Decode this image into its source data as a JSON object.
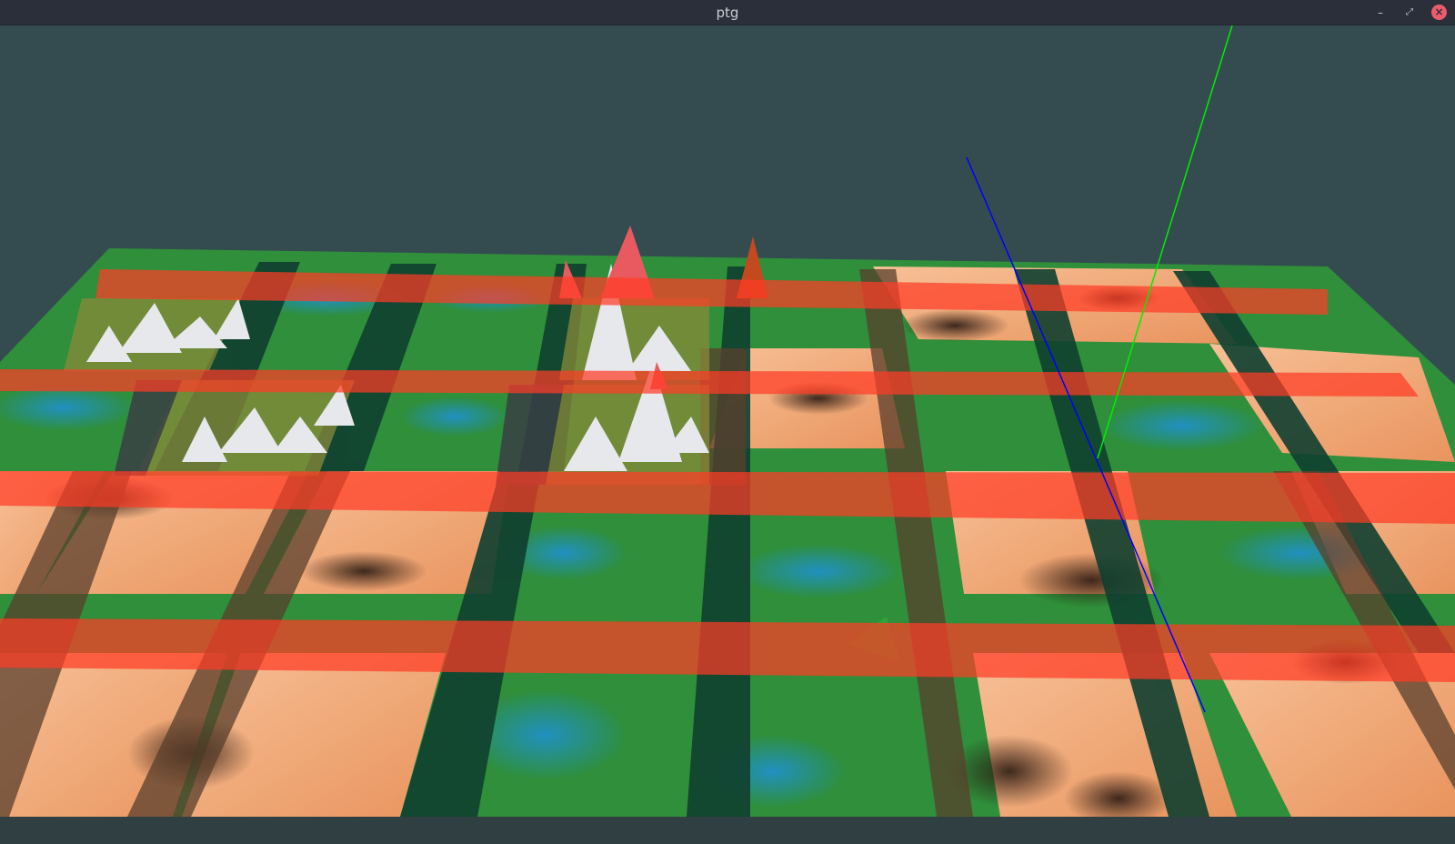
{
  "window": {
    "title": "ptg",
    "controls": {
      "minimize_glyph": "–",
      "maximize_glyph": "⤢",
      "close_glyph": "×"
    }
  },
  "viewport": {
    "content": "3d-terrain-render",
    "colors": {
      "background": "#344c50",
      "terrain_green": "#2f8f3a",
      "terrain_water": "#1e8fd0",
      "terrain_sand": "#f0a878",
      "terrain_dark": "#3a2a20",
      "road_red": "#ff3a2a",
      "road_dark": "#0e3a30",
      "snow": "#e8eaee",
      "axis_x": "#0000ff",
      "axis_y": "#00ff00"
    }
  }
}
